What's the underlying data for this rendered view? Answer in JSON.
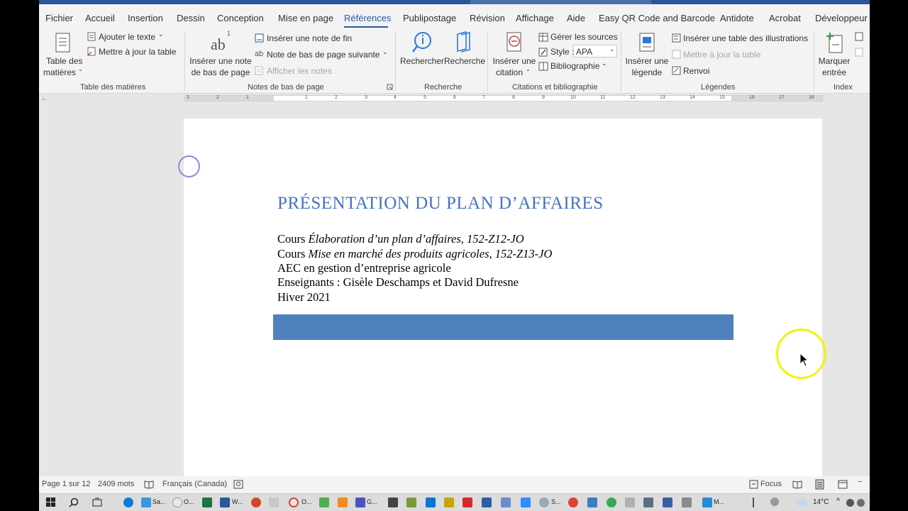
{
  "menu": {
    "tabs": [
      {
        "label": "Fichier"
      },
      {
        "label": "Accueil"
      },
      {
        "label": "Insertion"
      },
      {
        "label": "Dessin"
      },
      {
        "label": "Conception"
      },
      {
        "label": "Mise en page"
      },
      {
        "label": "Références"
      },
      {
        "label": "Publipostage"
      },
      {
        "label": "Révision"
      },
      {
        "label": "Affichage"
      },
      {
        "label": "Aide"
      },
      {
        "label": "Easy QR Code and Barcode"
      },
      {
        "label": "Antidote"
      },
      {
        "label": "Acrobat"
      },
      {
        "label": "Développeur"
      }
    ],
    "active": "Références"
  },
  "ribbon": {
    "toc": {
      "btn_line1": "Table des",
      "btn_line2": "matières",
      "add_text": "Ajouter le texte",
      "update": "Mettre à jour la table",
      "group": "Table des matières"
    },
    "footnotes": {
      "insert_line1": "Insérer une note",
      "insert_line2": "de bas de page",
      "icon_text": "ab",
      "icon_sup": "1",
      "endnote": "Insérer une note de fin",
      "next": "Note de bas de page suivante",
      "show": "Afficher les notes",
      "group": "Notes de bas de page"
    },
    "research": {
      "search": "Rechercher",
      "researcher": "Recherche",
      "group": "Recherche"
    },
    "citations": {
      "insert_line1": "Insérer une",
      "insert_line2": "citation",
      "manage": "Gérer les sources",
      "style_label": "Style :",
      "style_value": "APA",
      "bibliography": "Bibliographie",
      "group": "Citations et bibliographie"
    },
    "captions": {
      "insert_line1": "Insérer une",
      "insert_line2": "légende",
      "table_figures": "Insérer une table des illustrations",
      "update": "Mettre à jour la table",
      "crossref": "Renvoi",
      "group": "Légendes"
    },
    "index": {
      "mark_line1": "Marquer",
      "mark_line2": "entrée",
      "group": "Index"
    }
  },
  "ruler": {
    "ticks": [
      "3",
      "2",
      "1",
      "1",
      "2",
      "3",
      "4",
      "5",
      "6",
      "7",
      "8",
      "9",
      "10",
      "11",
      "12",
      "13",
      "14",
      "15",
      "16",
      "17",
      "18"
    ]
  },
  "document": {
    "title": "PRÉSENTATION DU PLAN D’AFFAIRES",
    "lines": [
      {
        "prefix": "Cours ",
        "italic": "Élaboration d’un plan d’affaires, 152-Z12-JO"
      },
      {
        "prefix": "Cours ",
        "italic": "Mise en marché des produits agricoles, 152-Z13-JO"
      },
      {
        "prefix": "AEC en gestion d’entreprise agricole",
        "italic": ""
      },
      {
        "prefix": "Enseignants : Gisèle Deschamps et David Dufresne",
        "italic": ""
      },
      {
        "prefix": "Hiver 2021",
        "italic": ""
      }
    ],
    "bar_color": "#4f81bd"
  },
  "status": {
    "page": "Page 1 sur 12",
    "words": "2409 mots",
    "language": "Français (Canada)",
    "focus": "Focus"
  },
  "taskbar": {
    "labels": [
      "Sa...",
      "O...",
      "W...",
      "O...",
      "G...",
      "S...",
      "M..."
    ],
    "temperature": "14°C"
  },
  "colors": {
    "accent": "#2b579a",
    "title_blue": "#4472c4"
  }
}
